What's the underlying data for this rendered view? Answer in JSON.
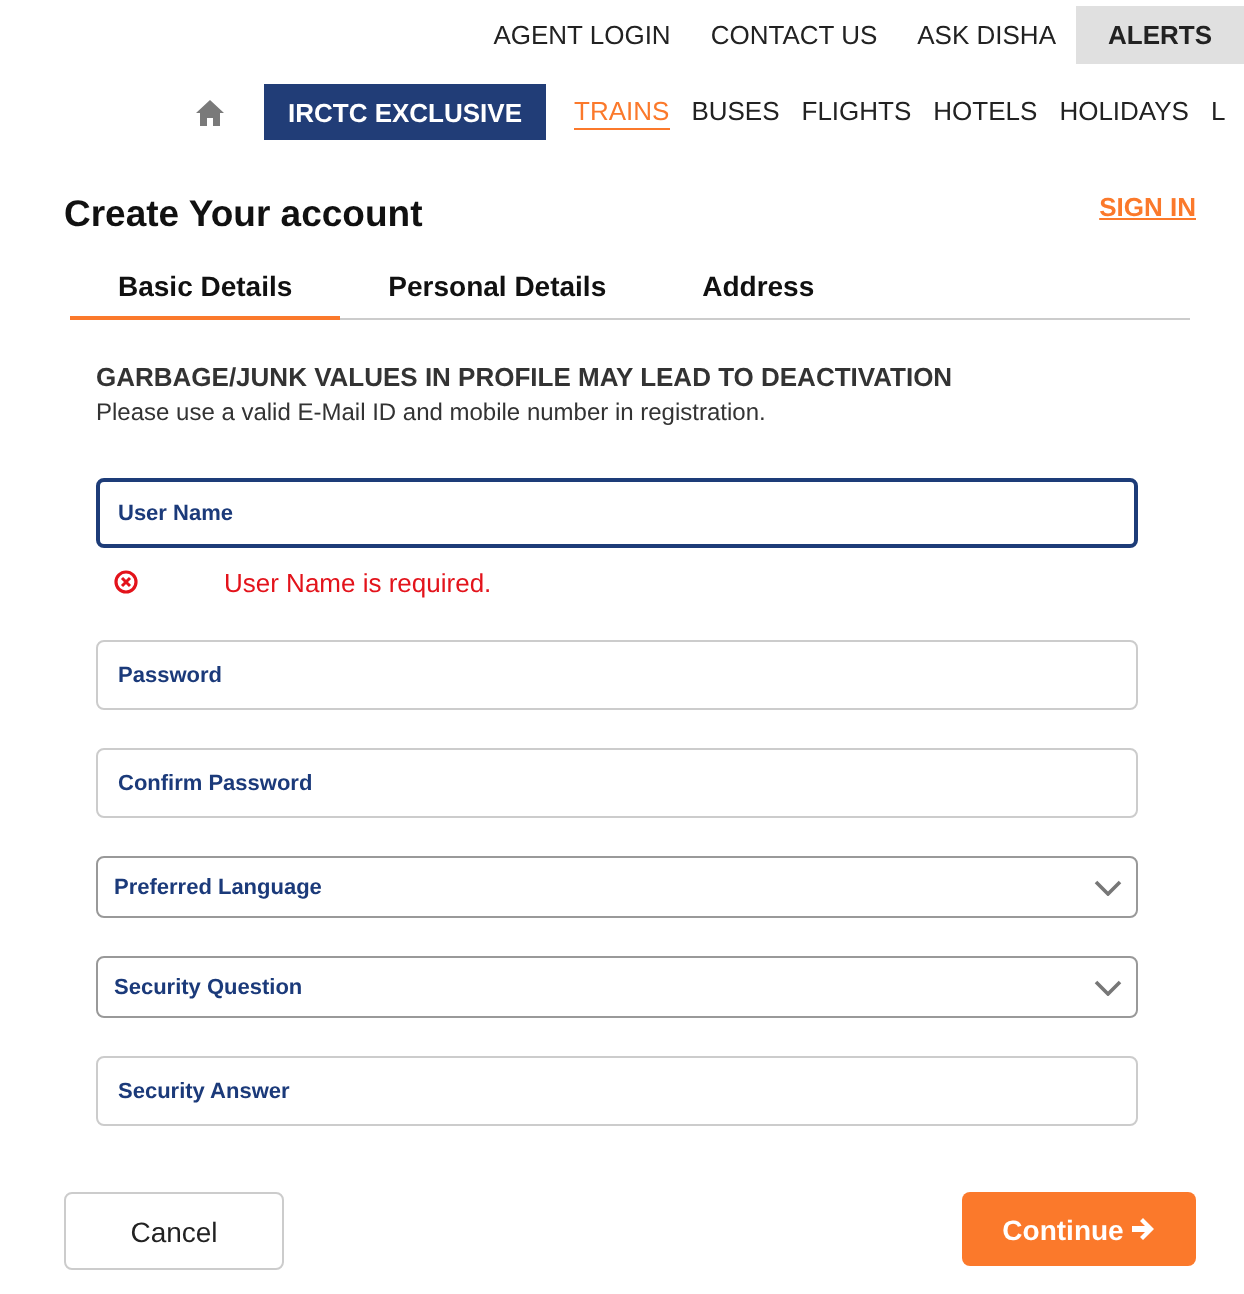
{
  "top_links": [
    {
      "label": "AGENT LOGIN",
      "highlighted": false
    },
    {
      "label": "CONTACT US",
      "highlighted": false
    },
    {
      "label": "ASK DISHA",
      "highlighted": false
    },
    {
      "label": "ALERTS",
      "highlighted": true
    }
  ],
  "nav": {
    "exclusive_button": "IRCTC EXCLUSIVE",
    "items": [
      {
        "label": "TRAINS",
        "selected": true
      },
      {
        "label": "BUSES",
        "selected": false
      },
      {
        "label": "FLIGHTS",
        "selected": false
      },
      {
        "label": "HOTELS",
        "selected": false
      },
      {
        "label": "HOLIDAYS",
        "selected": false
      },
      {
        "label": "L",
        "selected": false
      }
    ]
  },
  "form": {
    "title": "Create Your account",
    "sign_in": "SIGN IN",
    "tabs": [
      {
        "label": "Basic Details",
        "selected": true
      },
      {
        "label": "Personal Details",
        "selected": false
      },
      {
        "label": "Address",
        "selected": false
      }
    ],
    "notice": {
      "heading": "GARBAGE/JUNK VALUES IN PROFILE MAY LEAD TO DEACTIVATION",
      "text": "Please use a valid E-Mail ID and mobile number in registration."
    },
    "fields": [
      {
        "kind": "text",
        "placeholder": "User Name",
        "focused": true,
        "error": "User Name is required."
      },
      {
        "kind": "password",
        "placeholder": "Password",
        "focused": false
      },
      {
        "kind": "password",
        "placeholder": "Confirm Password",
        "focused": false
      },
      {
        "kind": "select",
        "placeholder": "Preferred Language",
        "focused": false
      },
      {
        "kind": "select",
        "placeholder": "Security Question",
        "focused": false
      },
      {
        "kind": "text",
        "placeholder": "Security Answer",
        "focused": false
      }
    ],
    "buttons": {
      "cancel": "Cancel",
      "continue": "Continue"
    }
  }
}
